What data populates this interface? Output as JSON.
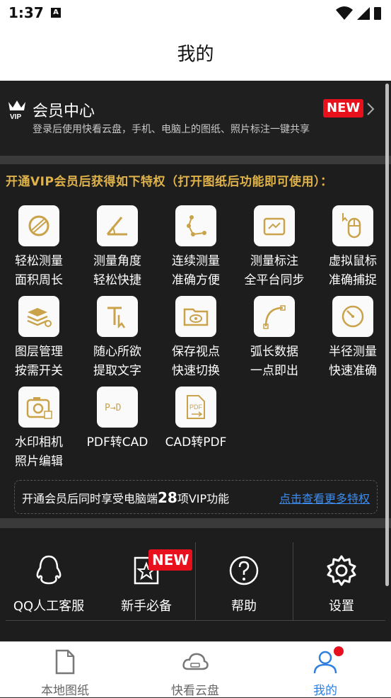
{
  "status_bar": {
    "time": "1:37",
    "notification_badge": "A"
  },
  "app_bar": {
    "title": "我的"
  },
  "vip_center": {
    "title": "会员中心",
    "subtitle": "登录后使用快看云盘，手机、电脑上的图纸、照片标注一键共享",
    "badge": "NEW"
  },
  "privileges": {
    "heading": "开通VIP会员后获得如下特权（打开图纸后功能即可使用）：",
    "features": [
      {
        "line1": "轻松测量",
        "line2": "面积周长",
        "icon": "area-measure-icon"
      },
      {
        "line1": "测量角度",
        "line2": "轻松快捷",
        "icon": "angle-measure-icon"
      },
      {
        "line1": "连续测量",
        "line2": "准确方便",
        "icon": "continuous-measure-icon"
      },
      {
        "line1": "测量标注",
        "line2": "全平台同步",
        "icon": "annotation-sync-icon"
      },
      {
        "line1": "虚拟鼠标",
        "line2": "准确捕捉",
        "icon": "virtual-mouse-icon"
      },
      {
        "line1": "图层管理",
        "line2": "按需开关",
        "icon": "layer-manage-icon"
      },
      {
        "line1": "随心所欲",
        "line2": "提取文字",
        "icon": "extract-text-icon"
      },
      {
        "line1": "保存视点",
        "line2": "快速切换",
        "icon": "save-viewpoint-icon"
      },
      {
        "line1": "弧长数据",
        "line2": "一点即出",
        "icon": "arc-length-icon"
      },
      {
        "line1": "半径测量",
        "line2": "快速准确",
        "icon": "radius-measure-icon"
      },
      {
        "line1": "水印相机",
        "line2": "照片编辑",
        "icon": "watermark-camera-icon"
      },
      {
        "line1": "PDF转CAD",
        "line2": "",
        "icon": "pdf-to-cad-icon"
      },
      {
        "line1": "CAD转PDF",
        "line2": "",
        "icon": "cad-to-pdf-icon"
      }
    ],
    "bar_text_before": "开通会员后同时享受电脑端",
    "bar_number": "28",
    "bar_text_after": "项VIP功能",
    "bar_link": "点击查看更多特权"
  },
  "tools": [
    {
      "label": "QQ人工客服",
      "icon": "qq-icon"
    },
    {
      "label": "新手必备",
      "icon": "star-book-icon",
      "badge": "NEW"
    },
    {
      "label": "帮助",
      "icon": "help-icon"
    },
    {
      "label": "设置",
      "icon": "gear-icon"
    }
  ],
  "bottom_nav": [
    {
      "label": "本地图纸",
      "icon": "file-icon"
    },
    {
      "label": "快看云盘",
      "icon": "cloud-icon"
    },
    {
      "label": "我的",
      "icon": "user-icon",
      "active": true
    }
  ],
  "colors": {
    "accent_gold": "#e0b24a",
    "link_blue": "#3d8cf0",
    "badge_red": "#e8101c",
    "nav_active": "#2f7fe0"
  }
}
